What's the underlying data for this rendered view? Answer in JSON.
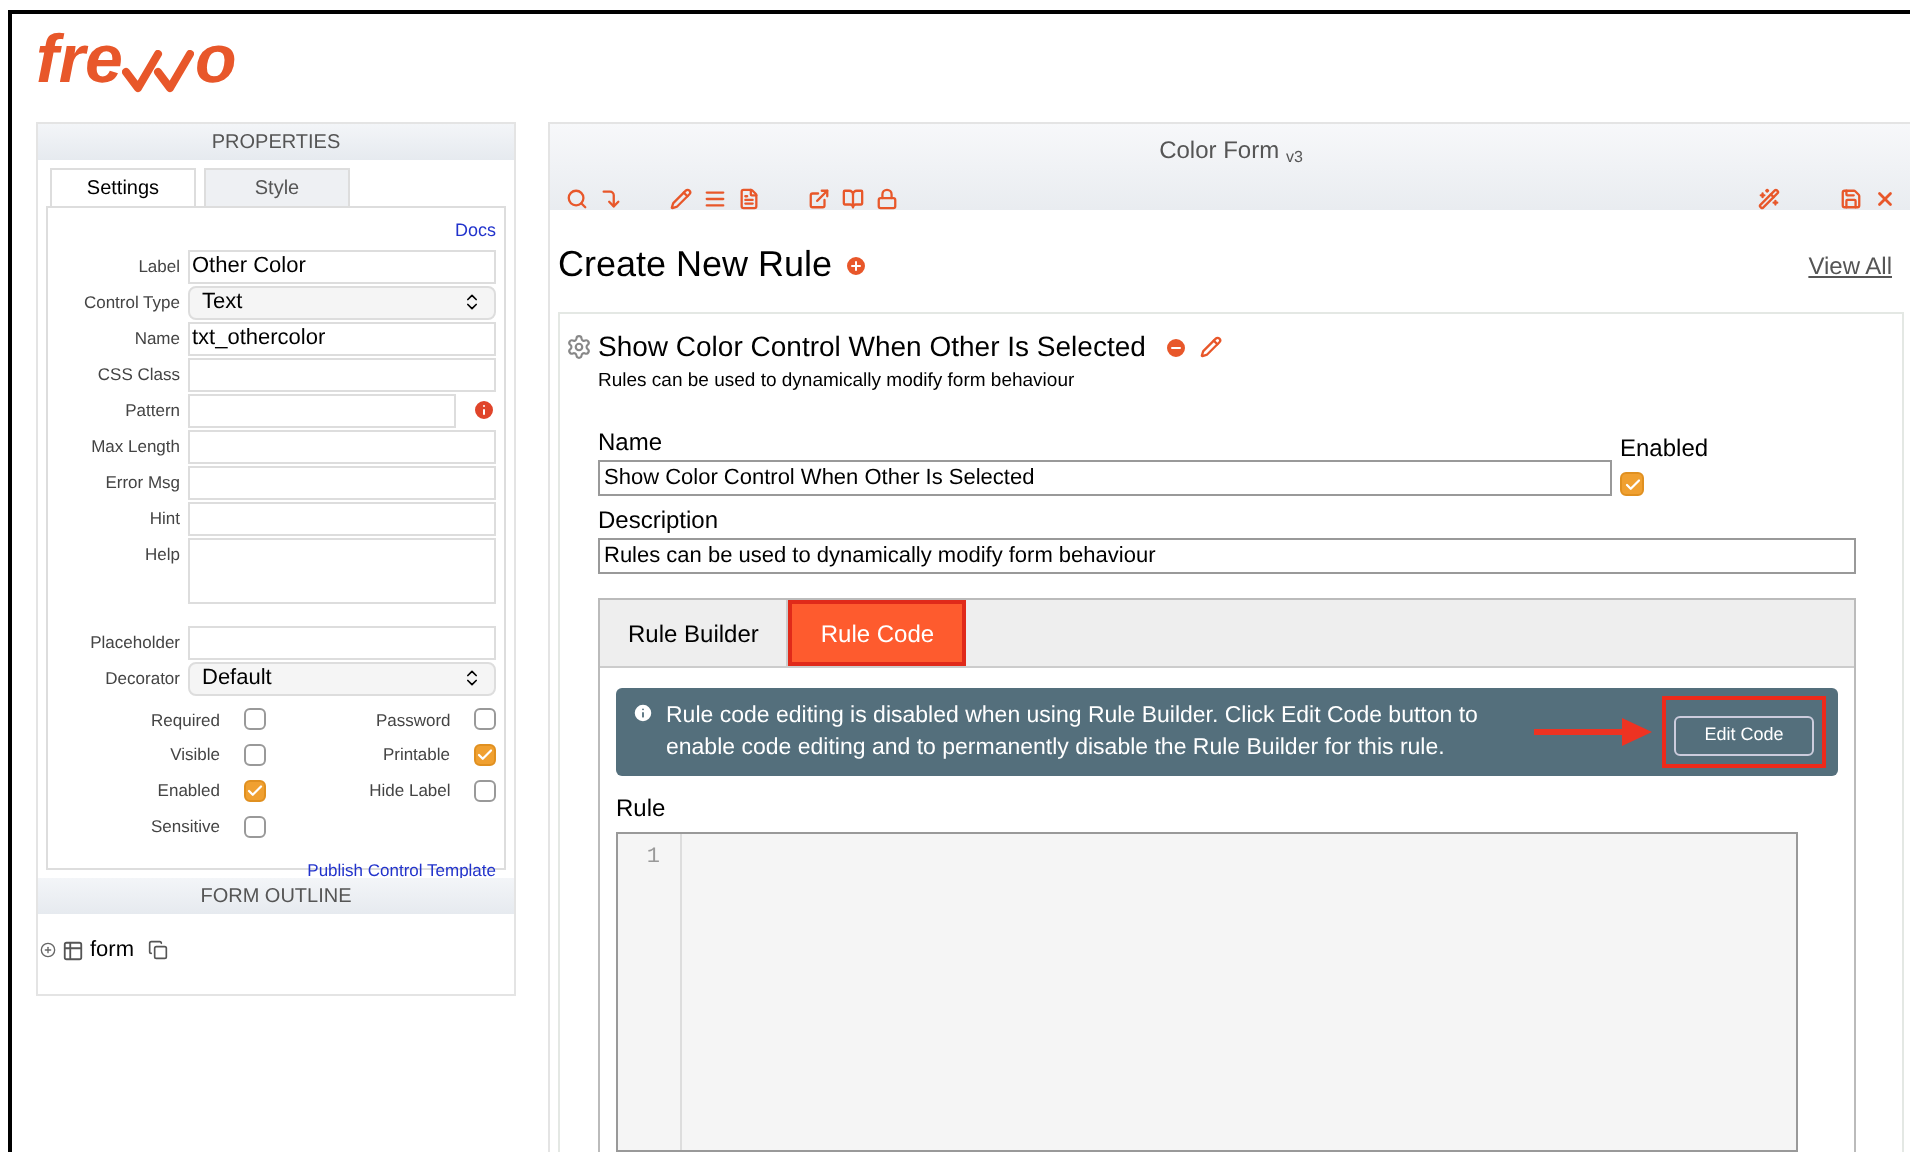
{
  "logo_parts": [
    "fre",
    "o"
  ],
  "properties": {
    "title": "PROPERTIES",
    "tabs": [
      {
        "label": "Settings",
        "selected": true
      },
      {
        "label": "Style",
        "selected": false
      }
    ],
    "docs_link": "Docs",
    "fields": [
      {
        "label": "Label",
        "kind": "text",
        "value": "Other Color"
      },
      {
        "label": "Control Type",
        "kind": "select",
        "value": "Text"
      },
      {
        "label": "Name",
        "kind": "text",
        "value": "txt_othercolor"
      },
      {
        "label": "CSS Class",
        "kind": "text"
      },
      {
        "label": "Pattern",
        "kind": "info"
      },
      {
        "label": "Max Length",
        "kind": "text"
      },
      {
        "label": "Error Msg",
        "kind": "text"
      },
      {
        "label": "Hint",
        "kind": "text"
      },
      {
        "label": "Help",
        "kind": "textarea"
      },
      {
        "label": "Placeholder",
        "kind": "text"
      },
      {
        "label": "Decorator",
        "kind": "select",
        "value": "Default"
      }
    ],
    "checkboxes": [
      {
        "label": "Required",
        "checked": false
      },
      {
        "label": "Password",
        "checked": false
      },
      {
        "label": "Visible",
        "checked": false
      },
      {
        "label": "Printable",
        "checked": true
      },
      {
        "label": "Enabled",
        "checked": true
      },
      {
        "label": "Hide Label",
        "checked": false
      },
      {
        "label": "Sensitive",
        "checked": false
      }
    ],
    "publish_link": "Publish Control Template"
  },
  "outline": {
    "title": "FORM OUTLINE",
    "item": "form"
  },
  "editor": {
    "title": "Color Form",
    "version": "v3",
    "heading": "Create New Rule",
    "view_all": "View All",
    "rule": {
      "title": "Show Color Control When Other Is Selected",
      "subtitle": "Rules can be used to dynamically modify form behaviour",
      "name_label": "Name",
      "name_value": "Show Color Control When Other Is Selected",
      "enabled_label": "Enabled",
      "enabled": true,
      "description_label": "Description",
      "description_value": "Rules can be used to dynamically modify form behaviour",
      "tabs": [
        {
          "label": "Rule Builder",
          "selected": false
        },
        {
          "label": "Rule Code",
          "selected": true
        }
      ],
      "notice": "Rule code editing is disabled when using Rule Builder. Click Edit Code button to enable code editing and to permanently disable the Rule Builder for this rule.",
      "edit_button": "Edit Code",
      "code_label": "Rule",
      "line_numbers": [
        "1"
      ]
    }
  }
}
